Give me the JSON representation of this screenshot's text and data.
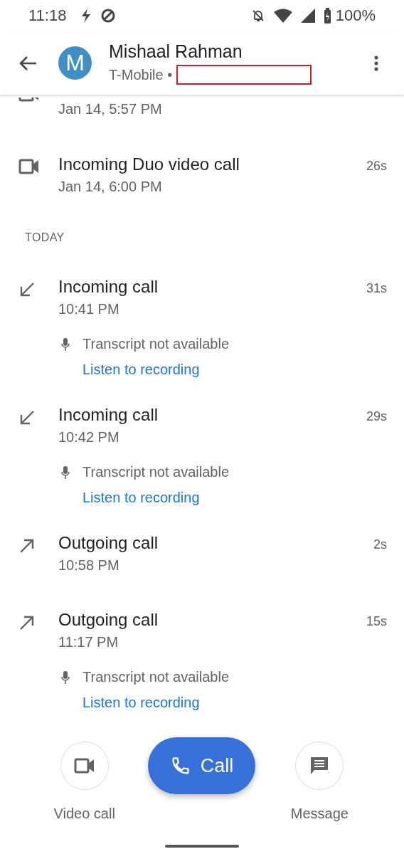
{
  "status_bar": {
    "time": "11:18",
    "battery": "100%"
  },
  "header": {
    "avatar_letter": "M",
    "name": "Mishaal Rahman",
    "subtitle": "T-Mobile •",
    "redacted": true
  },
  "history": [
    {
      "kind": "video",
      "time": "Jan 14, 5:57 PM"
    },
    {
      "kind": "video",
      "title": "Incoming Duo video call",
      "time": "Jan 14, 6:00 PM",
      "duration": "26s"
    },
    {
      "kind": "section",
      "title": "TODAY"
    },
    {
      "kind": "incoming",
      "title": "Incoming call",
      "time": "10:41 PM",
      "duration": "31s",
      "transcript": "Transcript not available",
      "link": "Listen to recording"
    },
    {
      "kind": "incoming",
      "title": "Incoming call",
      "time": "10:42 PM",
      "duration": "29s",
      "transcript": "Transcript not available",
      "link": "Listen to recording"
    },
    {
      "kind": "outgoing",
      "title": "Outgoing call",
      "time": "10:58 PM",
      "duration": "2s"
    },
    {
      "kind": "outgoing",
      "title": "Outgoing call",
      "time": "11:17 PM",
      "duration": "15s",
      "transcript": "Transcript not available",
      "link": "Listen to recording"
    }
  ],
  "actions": [
    {
      "kind": "video",
      "label": "Video call"
    },
    {
      "kind": "call",
      "label": "Call"
    },
    {
      "kind": "message",
      "label": "Message"
    }
  ]
}
